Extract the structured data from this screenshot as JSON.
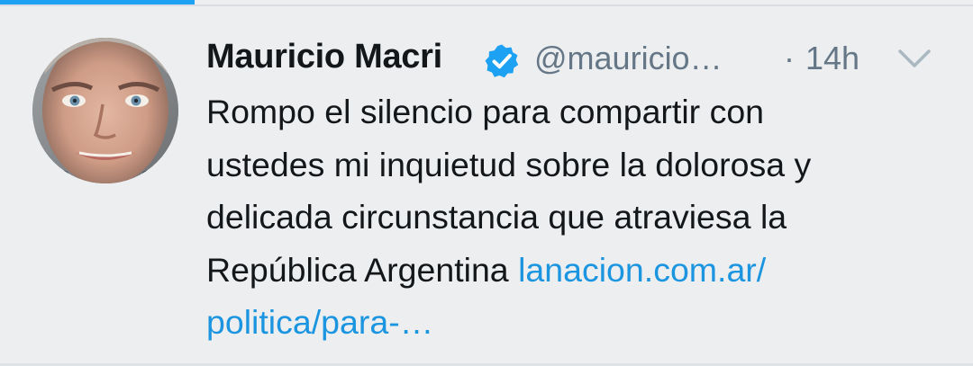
{
  "tweet": {
    "display_name": "Mauricio Macri",
    "handle": "@mauricio…",
    "separator": "·",
    "timestamp": "14h",
    "lines": [
      "Rompo el silencio para compartir con",
      "ustedes mi inquietud sobre la dolorosa y",
      "delicada circunstancia que atraviesa la",
      "República Argentina "
    ],
    "link_line1": "lanacion.com.ar/",
    "link_line2": "politica/para-…",
    "verified": true,
    "icons": {
      "verified": "verified-badge-icon",
      "menu": "chevron-down-icon"
    }
  },
  "colors": {
    "background": "#eceef0",
    "accent": "#1da1f2",
    "link": "#1b95e0",
    "text": "#14171a",
    "muted": "#657786"
  }
}
